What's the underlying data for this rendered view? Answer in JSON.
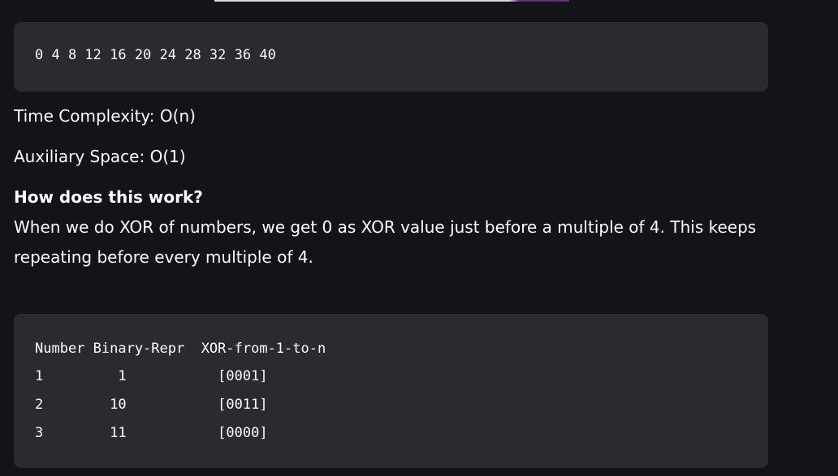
{
  "output_block": {
    "text": "0 4 8 12 16 20 24 28 32 36 40"
  },
  "time_complexity": "Time Complexity: O(n)",
  "auxiliary_space": "Auxiliary Space: O(1)",
  "how_heading": "How does this work?",
  "explanation": {
    "line1": "When we do XOR of numbers, we get 0 as XOR value just before a multiple of 4. This keeps",
    "line2": "repeating before every multiple of 4."
  },
  "table_block": {
    "header": "Number Binary-Repr  XOR-from-1-to-n",
    "rows": [
      "1         1           [0001]",
      "2        10           [0011]",
      "3        11           [0000]"
    ]
  }
}
